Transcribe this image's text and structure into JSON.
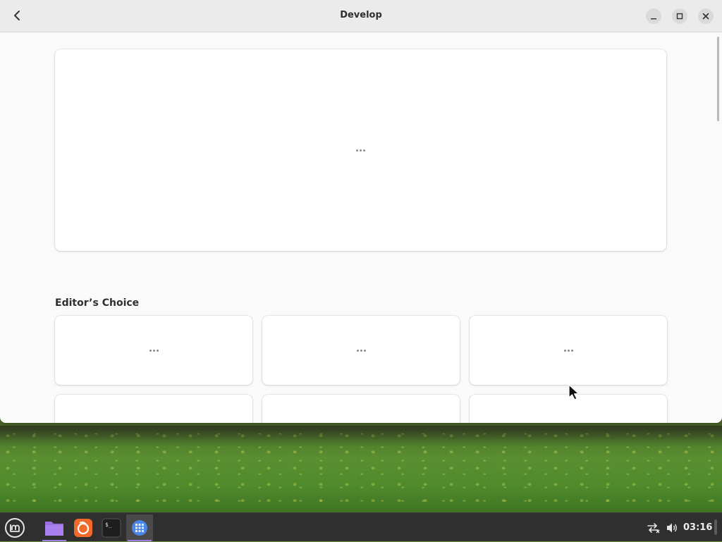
{
  "window": {
    "title": "Develop",
    "back_icon": "chevron-left-icon",
    "controls": [
      "minimize-icon",
      "maximize-icon",
      "close-icon"
    ]
  },
  "main": {
    "hero_status": "loading",
    "section_title": "Editor’s Choice",
    "tiles_status": "loading"
  },
  "taskbar": {
    "menu_icon": "mint-menu-icon",
    "apps": [
      {
        "name": "files",
        "icon": "folder-icon",
        "color": "#9b6fe0"
      },
      {
        "name": "firefox",
        "icon": "firefox-icon",
        "color": "#f06a2c"
      },
      {
        "name": "terminal",
        "icon": "terminal-icon",
        "color": "#1e1e1e"
      },
      {
        "name": "software",
        "icon": "software-icon",
        "color": "#4a86e8",
        "active": true
      }
    ],
    "tray": [
      "network-disconnected-icon",
      "volume-icon"
    ],
    "clock": "03:16"
  },
  "colors": {
    "accent": "#9f7aea",
    "window_bg": "#fafafa",
    "headerbar_bg": "#ebebeb",
    "taskbar_bg": "#2f2f2f"
  }
}
